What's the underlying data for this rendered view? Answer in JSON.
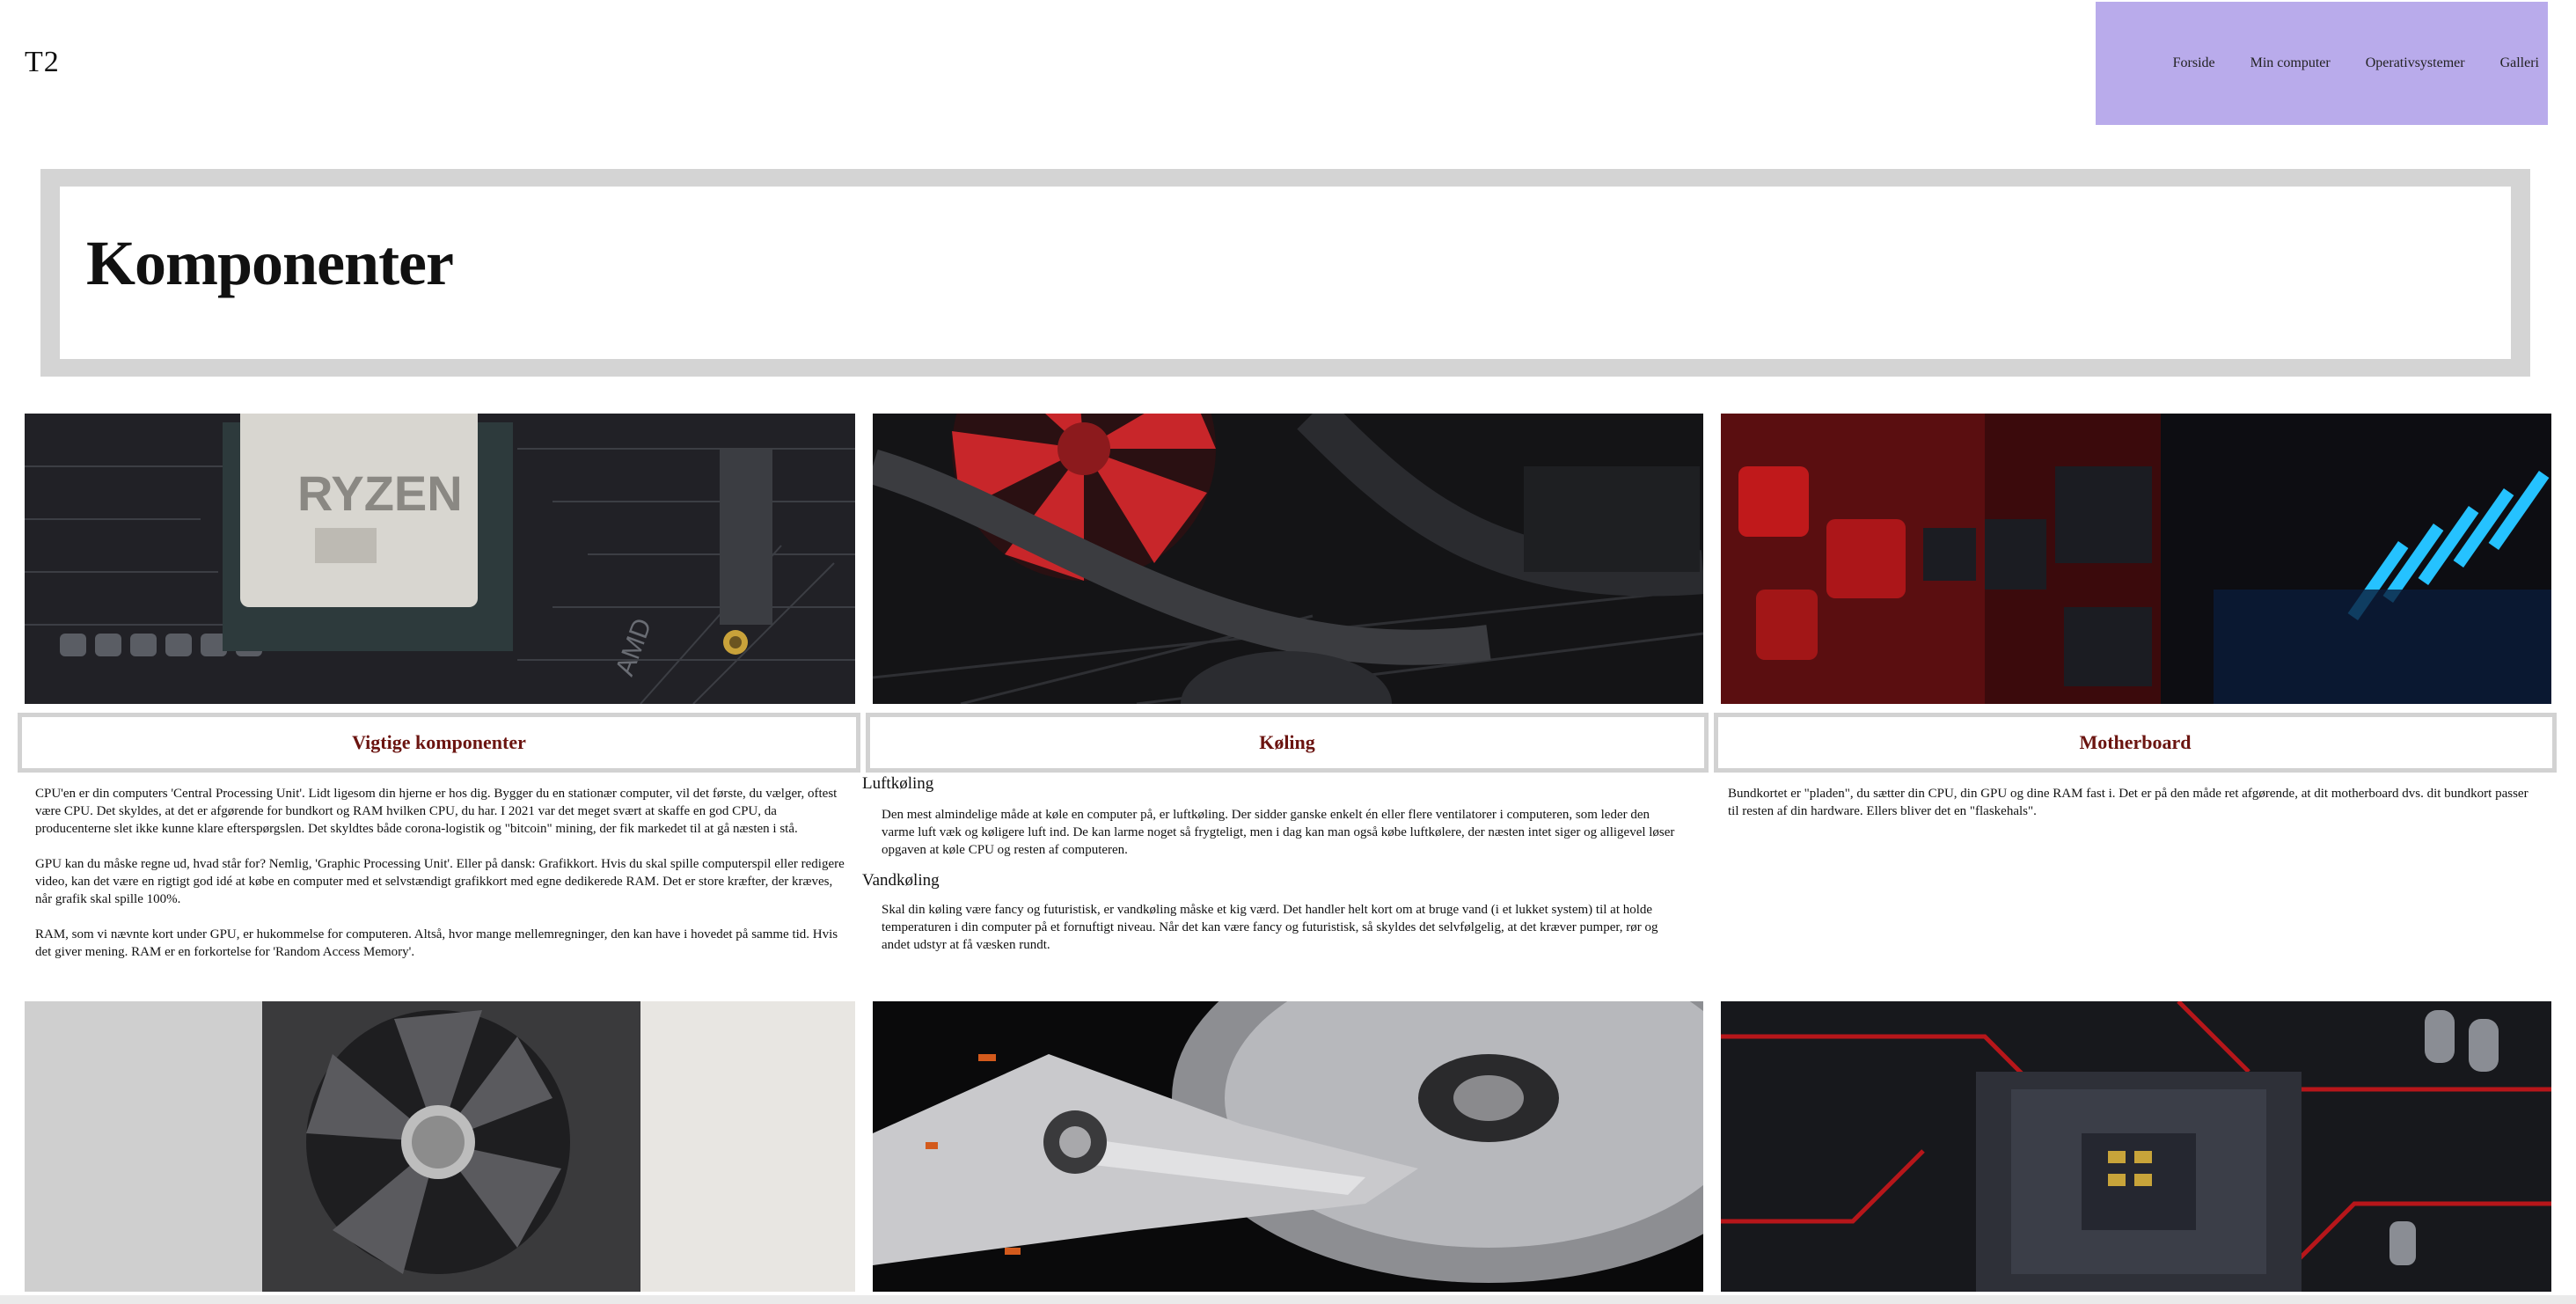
{
  "header": {
    "logo": "T2",
    "nav": [
      "Forside",
      "Min computer",
      "Operativsystemer",
      "Galleri"
    ]
  },
  "page_title": "Komponenter",
  "sections": {
    "vigtige": {
      "heading": "Vigtige komponenter",
      "paragraphs": [
        "CPU'en er din computers 'Central Processing Unit'. Lidt ligesom din hjerne er hos dig. Bygger du en stationær computer, vil det første, du vælger, oftest være CPU. Det skyldes, at det er afgørende for bundkort og RAM hvilken CPU, du har. I 2021 var det meget svært at skaffe en god CPU, da producenterne slet ikke kunne klare efterspørgslen. Det skyldtes både corona-logistik og \"bitcoin\" mining, der fik markedet til at gå næsten i stå.",
        "GPU kan du måske regne ud, hvad står for? Nemlig, 'Graphic Processing Unit'. Eller på dansk: Grafikkort. Hvis du skal spille computerspil eller redigere video, kan det være en rigtigt god idé at købe en computer med et selvstændigt grafikkort med egne dedikerede RAM. Det er store kræfter, der kræves, når grafik skal spille 100%.",
        "RAM, som vi nævnte kort under GPU, er hukommelse for computeren. Altså, hvor mange mellemregninger, den kan have i hovedet på samme tid. Hvis det giver mening. RAM er en forkortelse for 'Random Access Memory'."
      ]
    },
    "koling": {
      "heading": "Køling",
      "luft_title": "Luftkøling",
      "luft_text": "Den mest almindelige måde at køle en computer på, er luftkøling. Der sidder ganske enkelt én eller flere ventilatorer i computeren, som leder den varme luft væk og køligere luft ind. De kan larme noget så frygteligt, men i dag kan man også købe luftkølere, der næsten intet siger og alligevel løser opgaven at køle CPU og resten af computeren.",
      "vand_title": "Vandkøling",
      "vand_text": "Skal din køling være fancy og futuristisk, er vandkøling måske et kig værd. Det handler helt kort om at bruge vand (i et lukket system) til at holde temperaturen i din computer på et fornuftigt niveau. Når det kan være fancy og futuristisk, så skyldes det selvfølgelig, at det kræver pumper, rør og andet udstyr at få væsken rundt."
    },
    "motherboard": {
      "heading": "Motherboard",
      "text": "Bundkortet er \"pladen\", du sætter din CPU, din GPU og dine RAM fast i. Det er på den måde ret afgørende, at dit motherboard dvs. dit bundkort passer til resten af din hardware. Ellers bliver det en \"flaskehals\"."
    }
  },
  "images": {
    "cpu_chip_label": "RYZEN",
    "cpu_brand": "AMD"
  },
  "colors": {
    "nav_bg": "#b9abeb",
    "heading_red": "#6b1410",
    "frame_gray": "#d4d4d4"
  }
}
